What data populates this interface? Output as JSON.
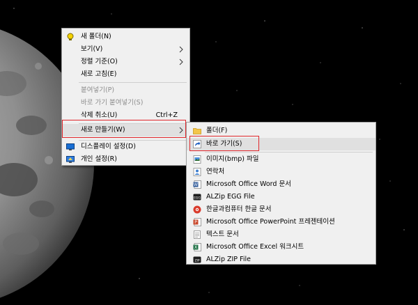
{
  "main_menu": {
    "items": [
      {
        "label": "새 폴더(N)",
        "icon": "new-folder-icon"
      },
      {
        "label": "보기(V)",
        "submenu": true
      },
      {
        "label": "정렬 기준(O)",
        "submenu": true
      },
      {
        "label": "새로 고침(E)"
      },
      {
        "label": "붙여넣기(P)",
        "disabled": true
      },
      {
        "label": "바로 가기 붙여넣기(S)",
        "disabled": true
      },
      {
        "label": "삭제 취소(U)",
        "accel": "Ctrl+Z"
      },
      {
        "label": "새로 만들기(W)",
        "submenu": true,
        "highlighted": true
      },
      {
        "label": "디스플레이 설정(D)",
        "icon": "display-settings-icon"
      },
      {
        "label": "개인 설정(R)",
        "icon": "personalize-icon"
      }
    ]
  },
  "new_submenu": {
    "items": [
      {
        "label": "폴더(F)",
        "icon": "folder-icon"
      },
      {
        "label": "바로 가기(S)",
        "icon": "shortcut-icon",
        "highlighted": true
      },
      {
        "label": "이미지(bmp) 파일",
        "icon": "bitmap-image-icon"
      },
      {
        "label": "연락처",
        "icon": "contact-icon"
      },
      {
        "label": "Microsoft Office Word 문서",
        "icon": "word-document-icon"
      },
      {
        "label": "ALZip EGG File",
        "icon": "alzip-egg-icon"
      },
      {
        "label": "한글과컴퓨터 한글 문서",
        "icon": "hwp-document-icon"
      },
      {
        "label": "Microsoft Office PowerPoint 프레젠테이션",
        "icon": "powerpoint-icon"
      },
      {
        "label": "텍스트 문서",
        "icon": "text-document-icon"
      },
      {
        "label": "Microsoft Office Excel 워크시트",
        "icon": "excel-worksheet-icon"
      },
      {
        "label": "ALZip ZIP File",
        "icon": "alzip-zip-icon"
      }
    ]
  },
  "icon_text": {
    "egg": "EGG",
    "zip": "ZIP"
  },
  "colors": {
    "menu_bg": "#f0f0f0",
    "highlight_bg": "#e0e0e0",
    "annotation_red": "#e0262a",
    "desktop_bg": "#000000"
  }
}
